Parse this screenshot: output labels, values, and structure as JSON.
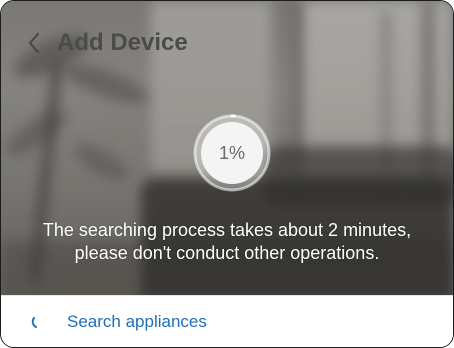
{
  "header": {
    "title": "Add Device",
    "back_icon": "chevron-left-icon"
  },
  "progress": {
    "percent_label": "1%",
    "value": 0.01
  },
  "message": {
    "line1": "The searching process takes about 2 minutes,",
    "line2": "please don't conduct other operations."
  },
  "bottom": {
    "label": "Search appliances",
    "icon": "loading-spinner-icon"
  },
  "colors": {
    "accent": "#1f6fb5",
    "title": "#4b4b4b",
    "message": "#ffffff"
  }
}
